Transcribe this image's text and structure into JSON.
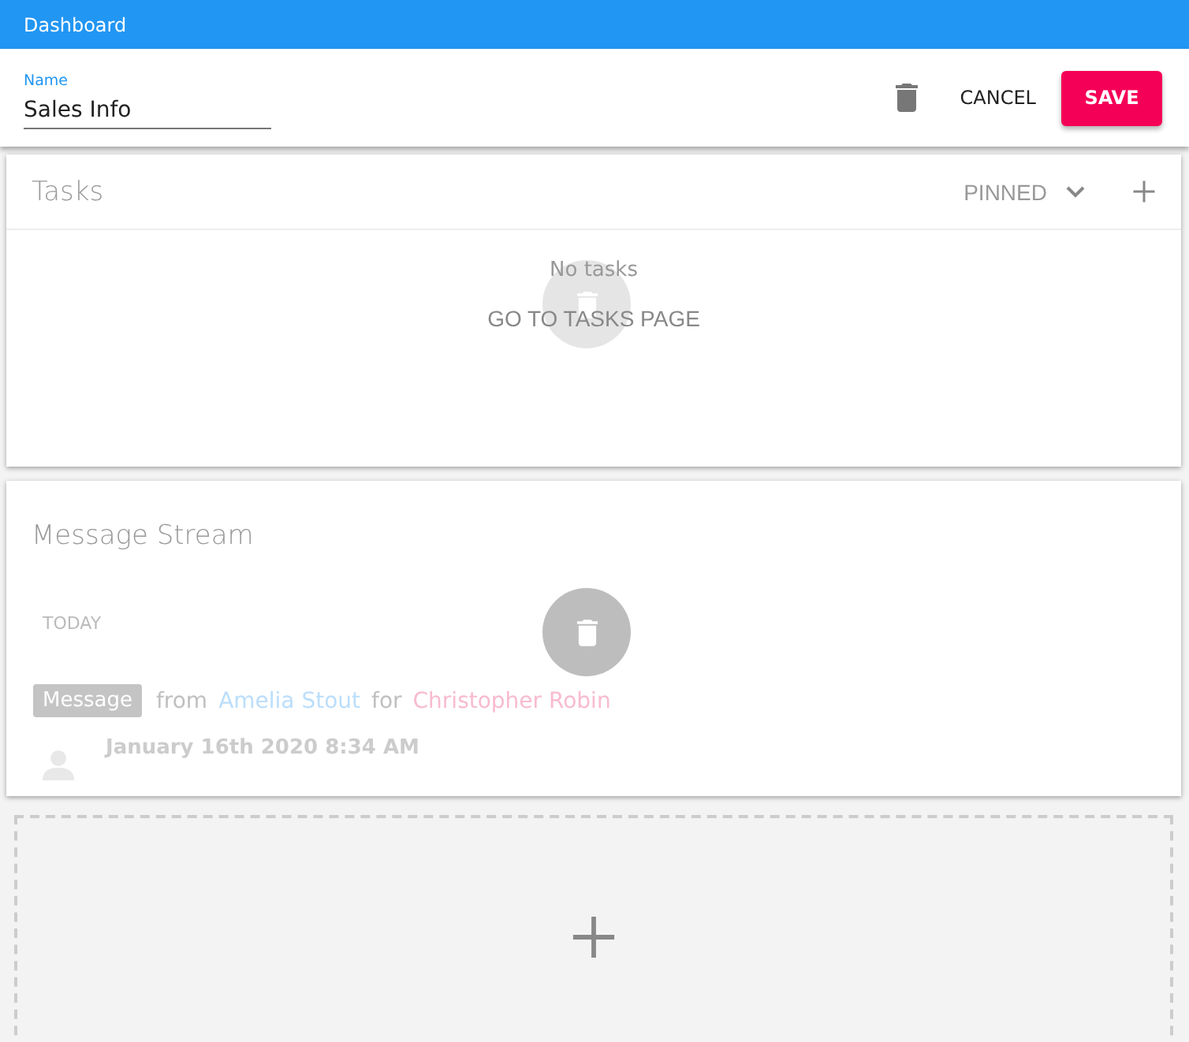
{
  "app_bar": {
    "title": "Dashboard"
  },
  "name_field": {
    "label": "Name",
    "value": "Sales Info"
  },
  "toolbar": {
    "cancel": "CANCEL",
    "save": "SAVE"
  },
  "widgets": [
    {
      "kind": "tasks",
      "title": "Tasks",
      "filter": "PINNED",
      "empty_text": "No tasks",
      "link": "GO TO TASKS PAGE"
    },
    {
      "kind": "messages",
      "title": "Message Stream",
      "groups": [
        {
          "heading": "TODAY",
          "messages": [
            {
              "type": "Message",
              "from_word": "from",
              "author": "Amelia Stout",
              "for_word": "for",
              "recipient": "Christopher Robin",
              "time": "January 16th 2020 8:34 AM"
            }
          ]
        }
      ]
    }
  ]
}
